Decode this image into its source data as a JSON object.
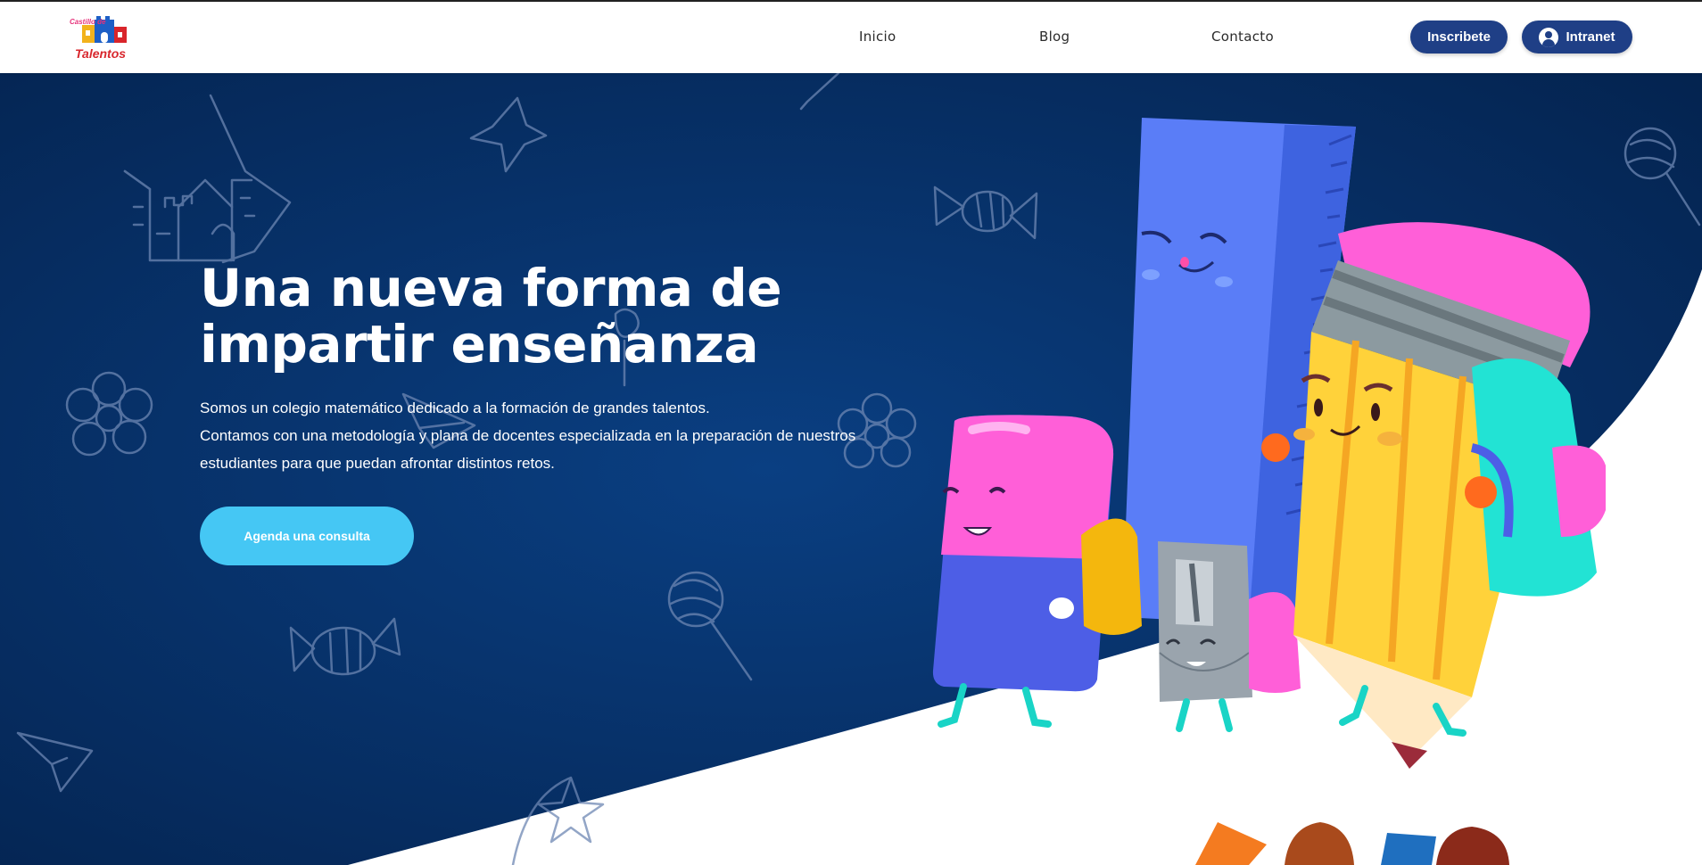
{
  "header": {
    "logo": {
      "top_text": "Castillo de",
      "main_text": "Talentos"
    },
    "nav": [
      {
        "label": "Inicio"
      },
      {
        "label": "Blog"
      },
      {
        "label": "Contacto"
      }
    ],
    "signup_label": "Inscribete",
    "intranet_label": "Intranet"
  },
  "hero": {
    "title_line1": "Una nueva forma de",
    "title_line2": "impartir enseñanza",
    "desc_line1": "Somos un colegio matemático dedicado a la formación de grandes talentos.",
    "desc_line2": "Contamos con una metodología y plana de docentes especializada en la preparación de nuestros",
    "desc_line3": "estudiantes para que puedan afrontar distintos retos.",
    "cta_label": "Agenda una consulta"
  },
  "colors": {
    "hero_bg_dark": "#04234f",
    "hero_bg_mid": "#0a3f82",
    "button_primary": "#1f3f86",
    "cta": "#45c7f4"
  },
  "icons": [
    "castle-doodle-icon",
    "star-doodle-icon",
    "candy-doodle-icon",
    "flower-doodle-icon",
    "lollipop-doodle-icon",
    "paper-plane-doodle-icon",
    "user-icon"
  ]
}
